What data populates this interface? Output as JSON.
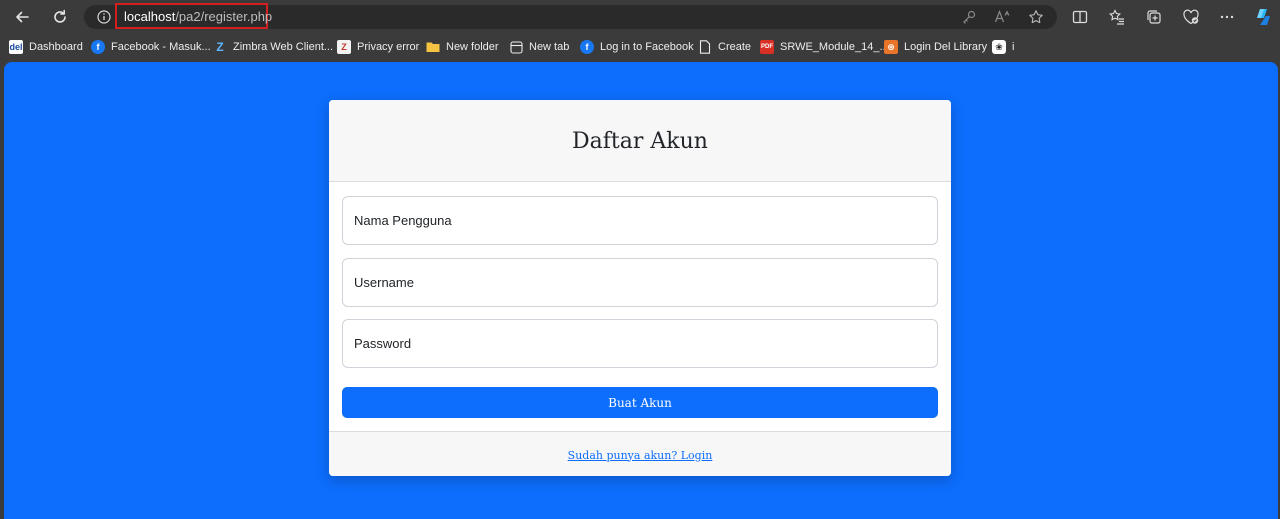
{
  "browser": {
    "url_host": "localhost",
    "url_path": "/pa2/register.php",
    "toolbar_icons": [
      "back-icon",
      "refresh-icon",
      "info-icon",
      "key-icon",
      "read-aloud-icon",
      "favorite-star-icon",
      "split-screen-icon",
      "favorites-icon",
      "collections-icon",
      "browser-essentials-icon",
      "more-icon",
      "copilot-icon"
    ],
    "bookmarks": [
      {
        "label": "Dashboard",
        "icon": "del-logo-icon"
      },
      {
        "label": "Facebook - Masuk...",
        "icon": "facebook-icon"
      },
      {
        "label": "Zimbra Web Client...",
        "icon": "zimbra-icon"
      },
      {
        "label": "Privacy error",
        "icon": "zimbra-error-icon"
      },
      {
        "label": "New folder",
        "icon": "folder-icon"
      },
      {
        "label": "New tab",
        "icon": "new-tab-icon"
      },
      {
        "label": "Log in to Facebook",
        "icon": "facebook-icon"
      },
      {
        "label": "Create",
        "icon": "document-icon"
      },
      {
        "label": "SRWE_Module_14_...",
        "icon": "pdf-icon"
      },
      {
        "label": "Login Del Library",
        "icon": "library-icon"
      },
      {
        "label": "i",
        "icon": "openai-icon"
      }
    ]
  },
  "form": {
    "title": "Daftar Akun",
    "fields": [
      {
        "placeholder": "Nama Pengguna"
      },
      {
        "placeholder": "Username"
      },
      {
        "placeholder": "Password"
      }
    ],
    "submit_label": "Buat Akun",
    "login_link": "Sudah punya akun? Login"
  },
  "colors": {
    "page_background": "#0d6efd",
    "button": "#0d6efd",
    "url_highlight_border": "#d31f1f"
  }
}
